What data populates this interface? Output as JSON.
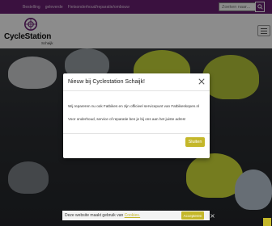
{
  "topbar": {
    "links": [
      "Bestelling",
      "geleverde",
      "Fietsonderhoud/reparatie/ombouw"
    ],
    "search_placeholder": "Zoeken naar..."
  },
  "header": {
    "logo_text": "CycleStation",
    "logo_sub": "Schaijk"
  },
  "modal": {
    "title": "Nieuw bij Cyclestation Schaijk!",
    "p1": "Wij repareren nu ook Fatbikes en zijn officieel servicepunt van Fatbikeskopen.nl",
    "p2": "Voor onderhoud, service of reparatie ben je bij ons aan het juiste adres!",
    "button": "Sluiten"
  },
  "cookie": {
    "text": "Deze website maakt gebruik van",
    "link": "Cookies.",
    "button": "Accepteren"
  },
  "colors": {
    "brand_purple": "#6b1f73",
    "accent_yellow": "#c4b72a"
  }
}
